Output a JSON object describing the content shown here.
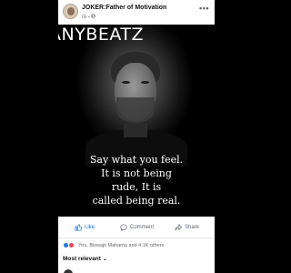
{
  "post": {
    "page_name": "JOKER:Father of Motivation",
    "meta": "6h • ",
    "more_icon": "•••",
    "watermark": "ANYBEATZ",
    "quote_lines": [
      "Say what you feel.",
      "It is not being",
      "rude, It is",
      "called being real."
    ]
  },
  "actions": {
    "like_label": "Like",
    "comment_label": "Comment",
    "share_label": "Share"
  },
  "reactions": {
    "text": "You, Biswajit Mahanta and 4.1K others"
  },
  "comments": {
    "sort_label": "Most relevant"
  },
  "colors": {
    "accent": "#1877f2",
    "love": "#f33e58"
  }
}
